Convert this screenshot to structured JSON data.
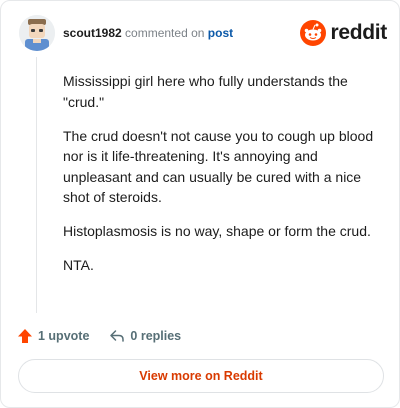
{
  "comment": {
    "username": "scout1982",
    "commented_on": "commented on",
    "post_link": "post",
    "paragraphs": [
      "Mississippi girl here who fully understands the \"crud.\"",
      "The crud doesn't not cause you to cough up blood nor is it life-threatening. It's annoying and unpleasant and can usually be cured with a nice shot of steroids.",
      "Histoplasmosis is no way, shape or form the crud.",
      "NTA."
    ]
  },
  "brand": {
    "name": "reddit",
    "accent": "#ff4500"
  },
  "actions": {
    "upvotes": "1 upvote",
    "replies": "0 replies",
    "upvote_color": "#ff4500"
  },
  "footer": {
    "view_more": "View more on Reddit"
  }
}
